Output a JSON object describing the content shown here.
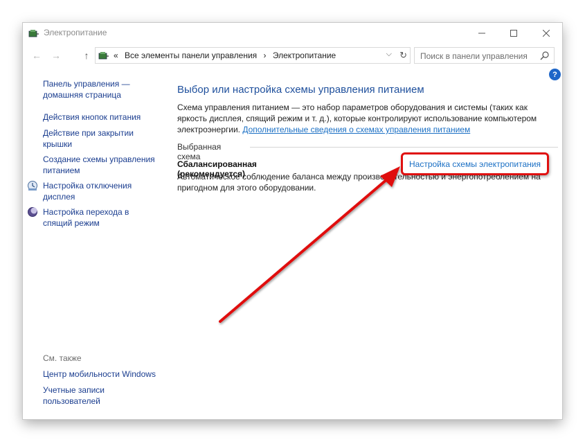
{
  "window": {
    "title": "Электропитание"
  },
  "titlebar": {
    "minimize_icon": "minimize-icon",
    "maximize_icon": "maximize-icon",
    "close_icon": "close-icon"
  },
  "address": {
    "prefix": "«",
    "crumbs": [
      "Все элементы панели управления",
      "›",
      "Электропитание"
    ]
  },
  "search": {
    "placeholder": "Поиск в панели управления"
  },
  "sidebar": {
    "items": [
      {
        "label_line1": "Панель управления —",
        "label_line2": "домашняя страница"
      },
      {
        "label_line1": "Действия кнопок питания"
      },
      {
        "label_line1": "Действие при закрытии",
        "label_line2": "крышки"
      },
      {
        "label_line1": "Создание схемы управления",
        "label_line2": "питанием"
      },
      {
        "label_line1": "Настройка отключения",
        "label_line2": "дисплея",
        "icon": "display-off-icon"
      },
      {
        "label_line1": "Настройка перехода в",
        "label_line2": "спящий режим",
        "icon": "sleep-moon-icon"
      }
    ],
    "see_also_title": "См. также",
    "see_also": [
      {
        "label_line1": "Центр мобильности Windows"
      },
      {
        "label_line1": "Учетные записи",
        "label_line2": "пользователей"
      }
    ]
  },
  "main": {
    "heading": "Выбор или настройка схемы управления питанием",
    "description": "Схема управления питанием — это набор параметров оборудования и системы (таких как яркость дисплея, спящий режим и т. д.), которые контролируют использование компьютером электроэнергии. ",
    "description_link": "Дополнительные сведения о схемах управления питанием",
    "selected_scheme_label": "Выбранная схема",
    "plan_name": "Сбалансированная (рекомендуется)",
    "plan_description": "Автоматическое соблюдение баланса между производительностью и энергопотреблением на пригодном для этого оборудовании.",
    "plan_settings_link": "Настройка схемы электропитания"
  },
  "annotation": {
    "color": "#e01010"
  },
  "colors": {
    "link": "#1a6fc4",
    "heading": "#1e4f9c",
    "help": "#1e66c8"
  }
}
